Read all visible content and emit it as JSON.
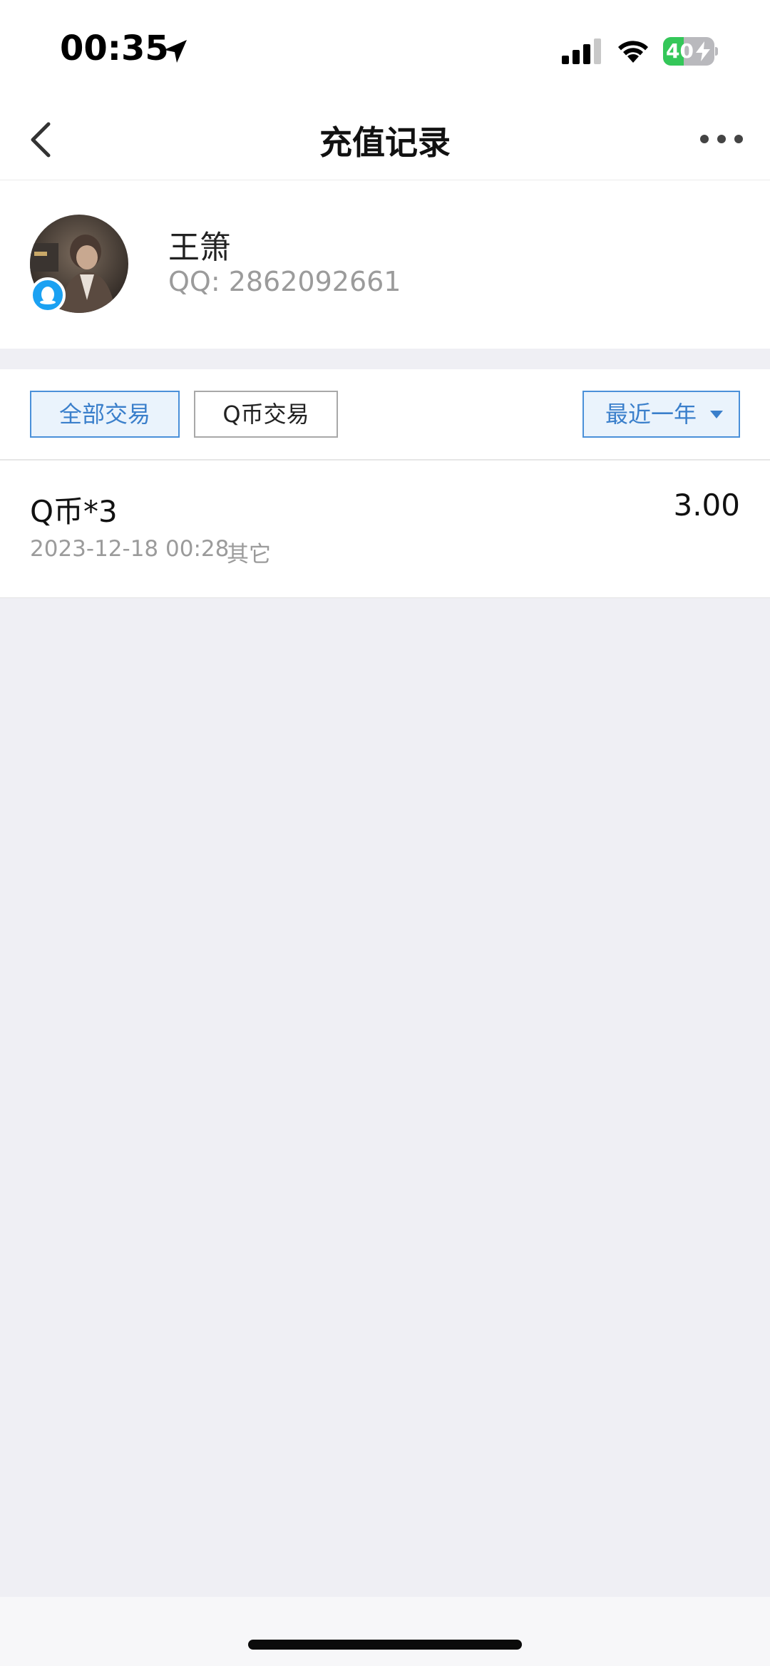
{
  "status_bar": {
    "time": "00:35",
    "battery_level": 40,
    "battery_text": "40"
  },
  "nav": {
    "title": "充值记录"
  },
  "profile": {
    "name": "王箫",
    "qq": "QQ: 2862092661"
  },
  "filters": {
    "all_label": "全部交易",
    "qcoin_label": "Q币交易",
    "range_label": "最近一年"
  },
  "records": [
    {
      "title": "Q币*3",
      "amount": "3.00",
      "datetime": "2023-12-18 00:28",
      "category": "其它"
    }
  ],
  "colors": {
    "accent": "#3a7fcb",
    "accent_border": "#4a90d9",
    "accent_bg": "#eaf3fc",
    "page_bg": "#efeff4",
    "battery_green": "#34c759",
    "qq_blue": "#1ba1f2"
  },
  "icons": {
    "location": "location-arrow-icon",
    "signal": "cellular-signal-icon",
    "wifi": "wifi-icon",
    "battery": "battery-charging-icon",
    "back": "chevron-left-icon",
    "more": "more-dots-icon",
    "qq": "qq-penguin-icon",
    "caret": "caret-down-icon"
  }
}
